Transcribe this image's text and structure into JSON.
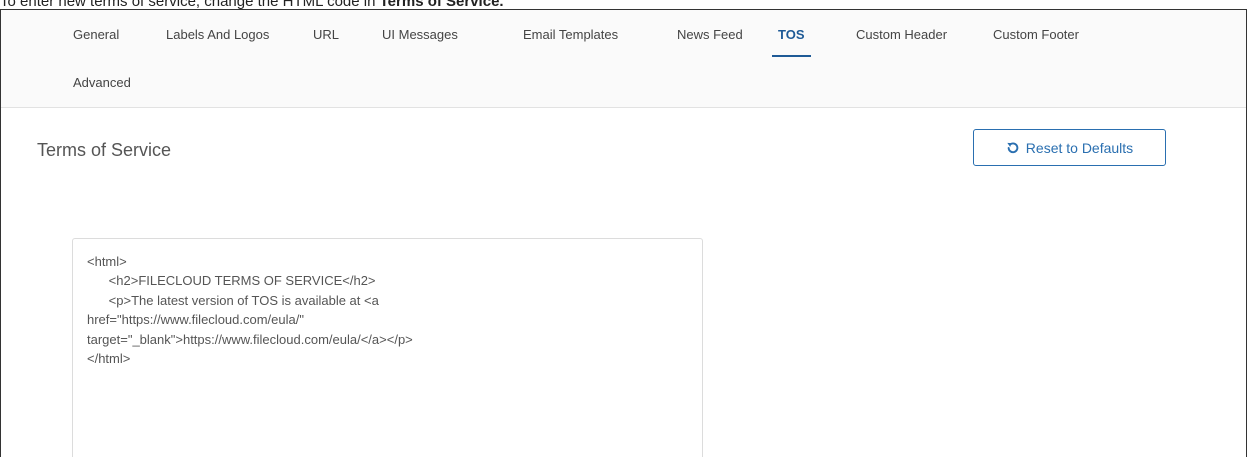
{
  "caption": {
    "prefix": "To enter new terms of service, change the HTML code in ",
    "bold": "Terms of Service."
  },
  "tabs": [
    {
      "label": "General"
    },
    {
      "label": "Labels And Logos"
    },
    {
      "label": "URL"
    },
    {
      "label": "UI Messages"
    },
    {
      "label": "Email Templates"
    },
    {
      "label": "News Feed"
    },
    {
      "label": "TOS",
      "active": true
    },
    {
      "label": "Custom Header"
    },
    {
      "label": "Custom Footer"
    },
    {
      "label": "Advanced"
    }
  ],
  "section": {
    "title": "Terms of Service",
    "reset_label": "Reset to Defaults",
    "reset_icon": "undo-icon"
  },
  "editor": {
    "value": "<html>\n      <h2>FILECLOUD TERMS OF SERVICE</h2>\n      <p>The latest version of TOS is available at <a\nhref=\"https://www.filecloud.com/eula/\"\ntarget=\"_blank\">https://www.filecloud.com/eula/</a></p>\n</html>"
  },
  "colors": {
    "accent": "#1e5a96",
    "button": "#2a6fb0"
  }
}
